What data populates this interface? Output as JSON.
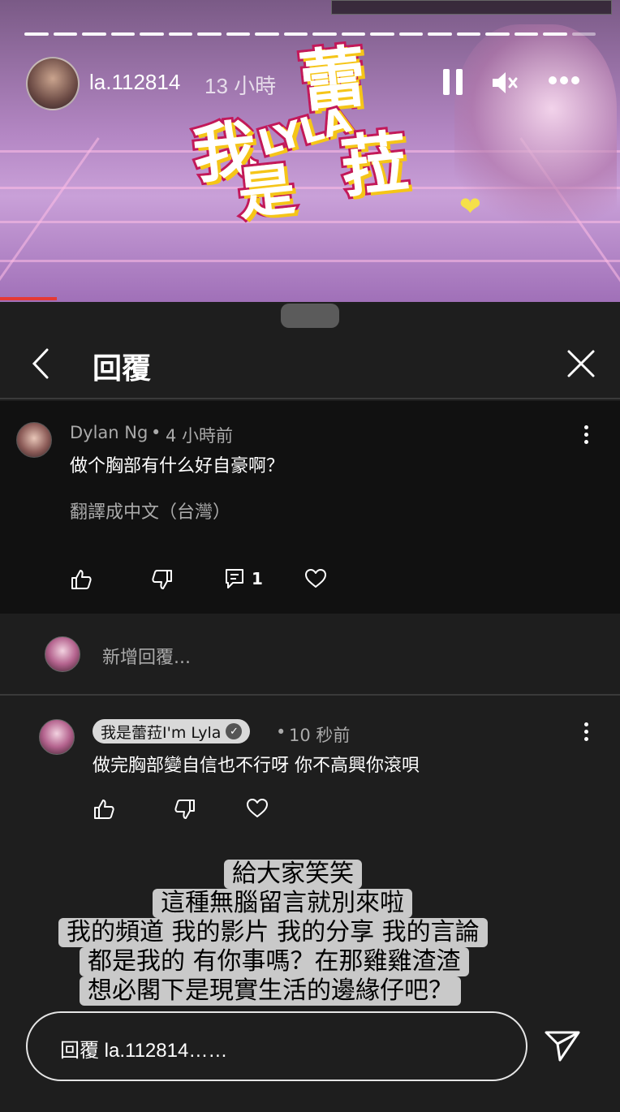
{
  "story": {
    "username": "la.112814",
    "time_ago": "13 小時",
    "progress_segments": 20,
    "progress_viewed": 19,
    "logo_chars": [
      "我",
      "是",
      "蕾",
      "菈"
    ],
    "logo_latin": "LYLA"
  },
  "sheet": {
    "title": "回覆"
  },
  "comment": {
    "author": "Dylan Ng",
    "separator": "•",
    "time": "4 小時前",
    "text": "做个胸部有什么好自豪啊？",
    "translate": "翻譯成中文（台灣）",
    "reply_count": "1"
  },
  "add_reply": {
    "placeholder": "新增回覆..."
  },
  "reply": {
    "author": "我是蕾菈I'm Lyla",
    "verified_mark": "✓",
    "separator": "•",
    "time": "10 秒前",
    "text": "做完胸部變自信也不行呀 你不高興你滾唄"
  },
  "caption": {
    "lines": [
      "給大家笑笑",
      "這種無腦留言就別來啦",
      "我的頻道 我的影片 我的分享 我的言論",
      "都是我的 有你事嗎？在那雞雞渣渣",
      "想必閣下是現實生活的邊緣仔吧？"
    ]
  },
  "footer": {
    "reply_placeholder": "回覆 la.112814……"
  },
  "colors": {
    "sheet_bg": "#1e1e1e",
    "comment_bg": "#111111",
    "caption_bg": "#c9c9c9",
    "logo_pink": "#c2185b",
    "logo_yellow": "#f5c518"
  }
}
